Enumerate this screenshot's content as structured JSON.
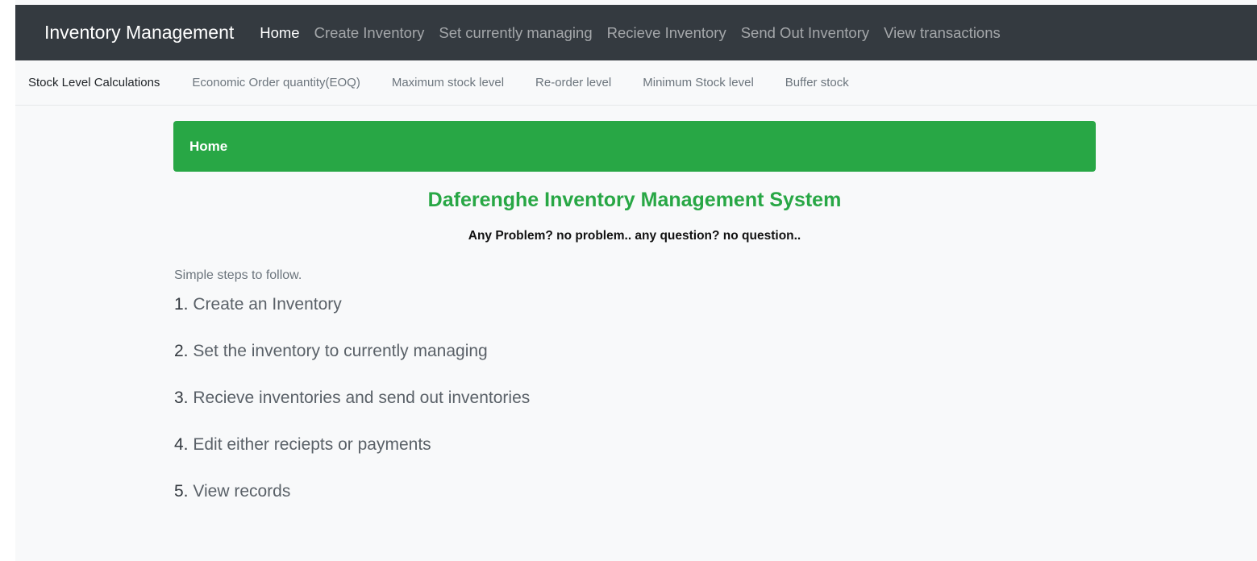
{
  "navbar": {
    "brand": "Inventory Management",
    "items": [
      {
        "label": "Home",
        "active": true
      },
      {
        "label": "Create Inventory",
        "active": false
      },
      {
        "label": "Set currently managing",
        "active": false
      },
      {
        "label": "Recieve Inventory",
        "active": false
      },
      {
        "label": "Send Out Inventory",
        "active": false
      },
      {
        "label": "View transactions",
        "active": false
      }
    ]
  },
  "subnav": {
    "brand": "Stock Level Calculations",
    "items": [
      {
        "label": "Economic Order quantity(EOQ)"
      },
      {
        "label": "Maximum stock level"
      },
      {
        "label": "Re-order level"
      },
      {
        "label": "Minimum Stock level"
      },
      {
        "label": "Buffer stock"
      }
    ]
  },
  "main": {
    "card_header": "Home",
    "title": "Daferenghe Inventory Management System",
    "tagline": "Any Problem? no problem.. any question? no question..",
    "steps_heading": "Simple steps to follow.",
    "steps": [
      {
        "num": "1.",
        "text": " Create an Inventory"
      },
      {
        "num": "2.",
        "text": " Set the inventory to currently managing"
      },
      {
        "num": "3.",
        "text": " Recieve inventories and send out inventories"
      },
      {
        "num": "4.",
        "text": " Edit either reciepts or payments"
      },
      {
        "num": "5.",
        "text": " View records"
      }
    ]
  },
  "colors": {
    "navbar_bg": "#343a40",
    "accent_green": "#28a745",
    "page_bg": "#f8f9fa"
  }
}
